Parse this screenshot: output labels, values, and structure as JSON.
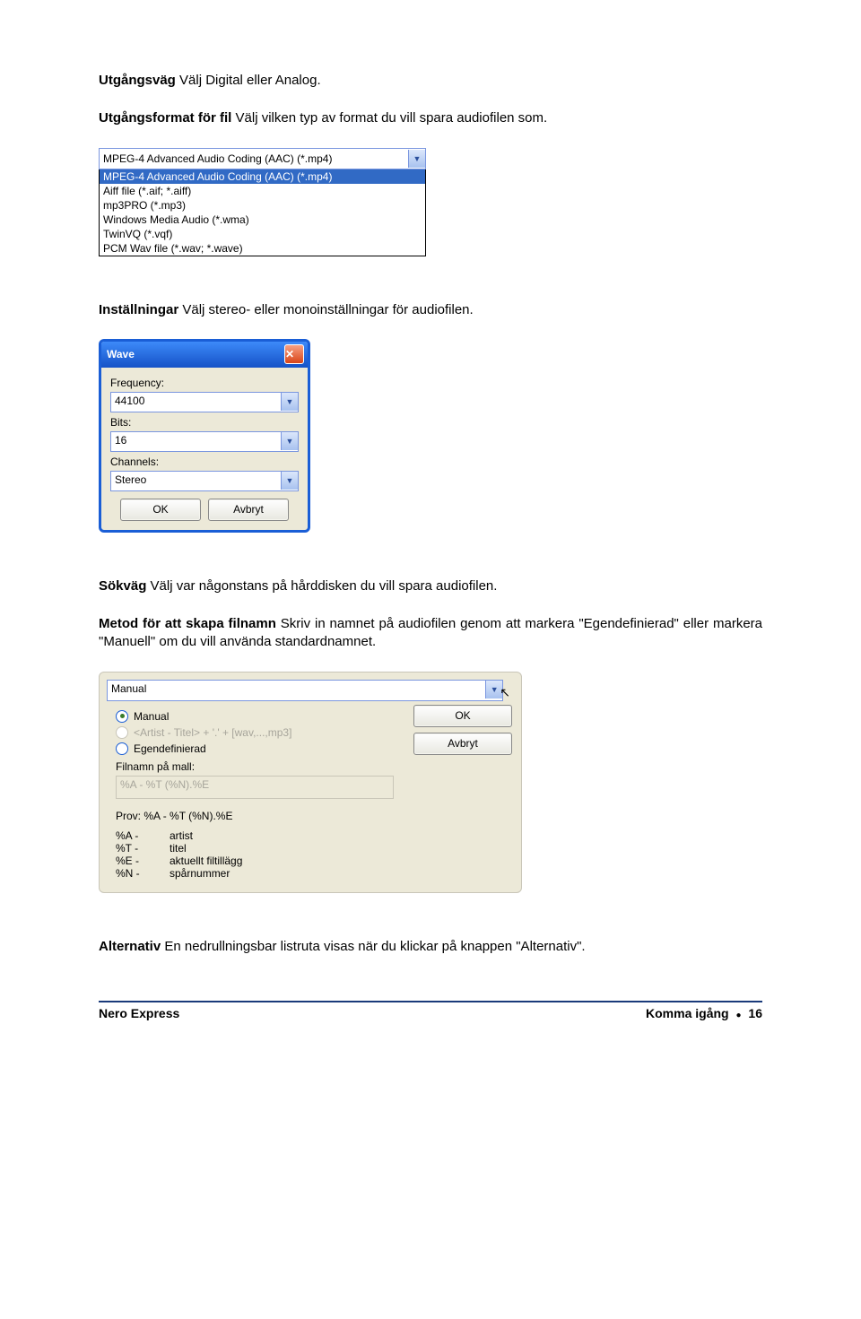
{
  "para1": {
    "bold": "Utgångsväg",
    "rest": " Välj Digital eller Analog."
  },
  "para2": {
    "bold": "Utgångsformat för fil",
    "rest": " Välj vilken typ av format du vill spara audiofilen som."
  },
  "para3": {
    "bold": "Inställningar",
    "rest": " Välj stereo- eller monoinställningar för audiofilen."
  },
  "para4": {
    "bold": "Sökväg",
    "rest": " Välj var någonstans på hårddisken du vill spara audiofilen."
  },
  "para5": {
    "bold": "Metod för att skapa filnamn",
    "rest": " Skriv in namnet på audiofilen genom att markera \"Egendefinierad\" eller markera \"Manuell\" om du vill använda standardnamnet."
  },
  "para6": {
    "bold": "Alternativ",
    "rest": " En nedrullningsbar listruta visas när du klickar på knappen \"Alternativ\"."
  },
  "formatCombo": {
    "selected": "MPEG-4 Advanced Audio Coding (AAC) (*.mp4)",
    "options": [
      "MPEG-4 Advanced Audio Coding (AAC) (*.mp4)",
      "Aiff file (*.aif; *.aiff)",
      "mp3PRO (*.mp3)",
      "Windows Media Audio (*.wma)",
      "TwinVQ (*.vqf)",
      "PCM Wav file (*.wav; *.wave)"
    ],
    "selectedIndex": 0
  },
  "waveDialog": {
    "title": "Wave",
    "frequency_label": "Frequency:",
    "frequency_value": "44100",
    "bits_label": "Bits:",
    "bits_value": "16",
    "channels_label": "Channels:",
    "channels_value": "Stereo",
    "ok_label": "OK",
    "cancel_label": "Avbryt"
  },
  "namePanel": {
    "combo_value": "Manual",
    "radio1_label": "Manual",
    "radio2_label": "<Artist - Titel> + '.' + [wav,...,mp3]",
    "radio3_label": "Egendefinierad",
    "filename_label": "Filnamn på mall:",
    "filename_value": "%A - %T (%N).%E",
    "prov_label": "Prov: %A - %T (%N).%E",
    "legend": [
      {
        "k": "%A -",
        "v": "artist"
      },
      {
        "k": "%T -",
        "v": "titel"
      },
      {
        "k": "%E -",
        "v": "aktuellt filtillägg"
      },
      {
        "k": "%N -",
        "v": "spårnummer"
      }
    ],
    "ok_label": "OK",
    "cancel_label": "Avbryt"
  },
  "footer": {
    "left": "Nero Express",
    "right_a": "Komma igång ",
    "right_b": " 16"
  }
}
